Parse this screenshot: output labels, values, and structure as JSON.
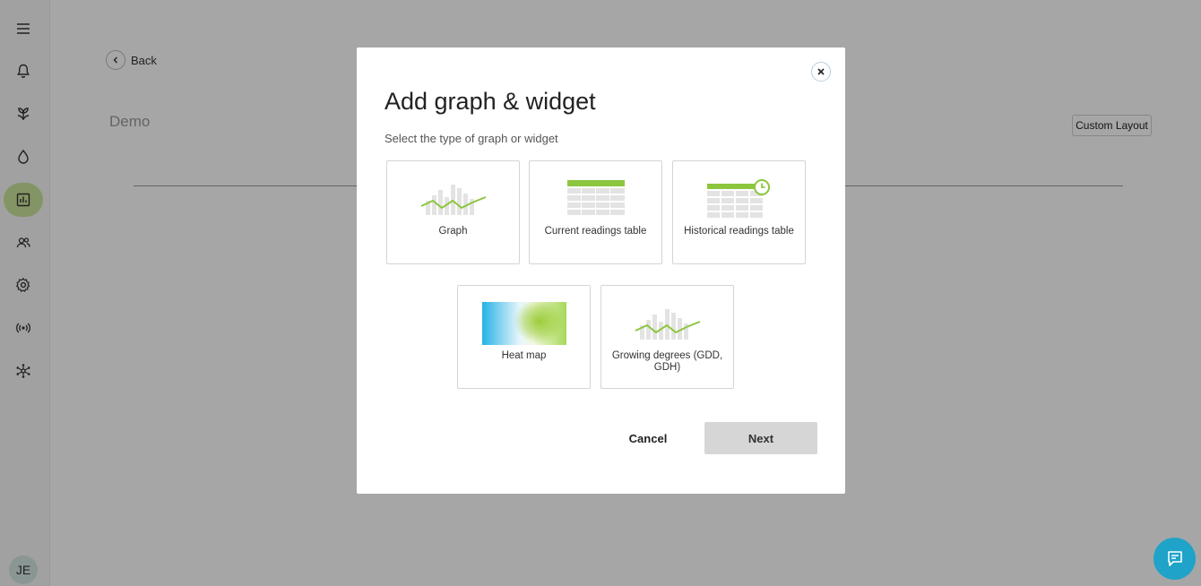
{
  "sidebar": {
    "items": [
      {
        "icon": "menu-icon"
      },
      {
        "icon": "bell-icon"
      },
      {
        "icon": "plant-icon"
      },
      {
        "icon": "water-drop-icon"
      },
      {
        "icon": "chart-icon",
        "active": true
      },
      {
        "icon": "users-icon"
      },
      {
        "icon": "gear-icon"
      },
      {
        "icon": "broadcast-icon"
      },
      {
        "icon": "network-icon"
      }
    ],
    "avatar": "JE"
  },
  "page": {
    "back_label": "Back",
    "title": "Demo",
    "custom_layout_label": "Custom Layout"
  },
  "modal": {
    "title": "Add graph & widget",
    "subtitle": "Select the type of graph or widget",
    "options": [
      {
        "label": "Graph",
        "icon": "graph-thumb"
      },
      {
        "label": "Current readings table",
        "icon": "table-thumb"
      },
      {
        "label": "Historical readings table",
        "icon": "history-table-thumb"
      },
      {
        "label": "Heat map",
        "icon": "heatmap-thumb"
      },
      {
        "label": "Growing degrees (GDD, GDH)",
        "icon": "gdd-thumb"
      }
    ],
    "cancel_label": "Cancel",
    "next_label": "Next"
  },
  "colors": {
    "accent_green": "#8cc63f",
    "active_nav": "#c9e59a",
    "chat_fab": "#1fa3c9"
  }
}
